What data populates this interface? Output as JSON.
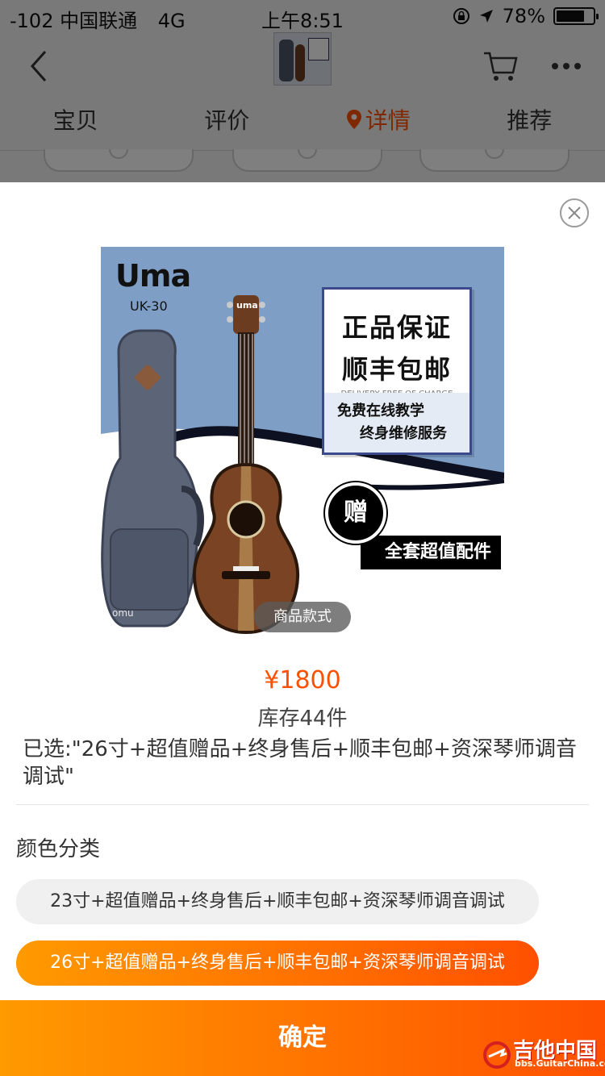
{
  "status_bar": {
    "carrier": "-102 中国联通",
    "network": "4G",
    "time": "上午8:51",
    "battery_text": "78%",
    "battery_level": 0.78
  },
  "nav": {
    "back_icon": "chevron-left-icon",
    "cart_icon": "cart-icon",
    "more_icon": "more-dots-icon"
  },
  "tabs": [
    {
      "label": "宝贝",
      "active": false
    },
    {
      "label": "评价",
      "active": false
    },
    {
      "label": "详情",
      "active": true
    },
    {
      "label": "推荐",
      "active": false
    }
  ],
  "product_image": {
    "brand": "Uma",
    "model": "UK-30",
    "promo_line1": "正品保证",
    "promo_line2": "顺丰包邮",
    "promo_en": "DELIVERY FREE OF CHARGE",
    "promo_line3": "免费在线教学",
    "promo_line4": "终身维修服务",
    "gift": "赠",
    "gift_banner": "全套超值配件",
    "style_label": "商品款式"
  },
  "price": "¥1800",
  "stock": "库存44件",
  "selected": "已选:\"26寸+超值赠品+终身售后+顺丰包邮+资深琴师调音调试\"",
  "section_title": "颜色分类",
  "options": [
    {
      "label": "23寸+超值赠品+终身售后+顺丰包邮+资深琴师调音调试",
      "selected": false
    },
    {
      "label": "26寸+超值赠品+终身售后+顺丰包邮+资深琴师调音调试",
      "selected": true
    }
  ],
  "confirm_label": "确定",
  "watermark": {
    "name": "吉他中国",
    "url": "bbs.GuitarChina.com"
  },
  "colors": {
    "accent": "#ff5000",
    "accent_start": "#ff9a00"
  }
}
